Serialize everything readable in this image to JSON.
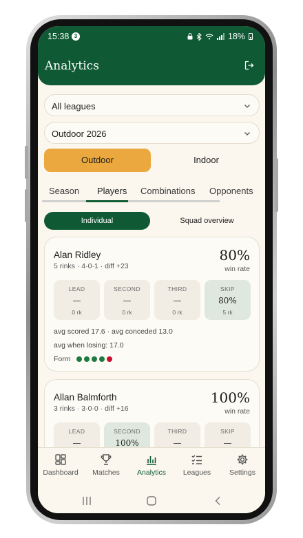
{
  "status_bar": {
    "time": "15:38",
    "notification_count": "3",
    "battery": "18%"
  },
  "app_bar": {
    "title": "Analytics"
  },
  "filters": {
    "league": "All leagues",
    "season": "Outdoor 2026"
  },
  "environment_toggle": {
    "outdoor": "Outdoor",
    "indoor": "Indoor",
    "selected": "Outdoor"
  },
  "tabs": [
    {
      "label": "Season"
    },
    {
      "label": "Players",
      "active": true
    },
    {
      "label": "Combinations"
    },
    {
      "label": "Opponents"
    }
  ],
  "view_toggle": {
    "individual": "Individual",
    "squad": "Squad overview",
    "selected": "Individual"
  },
  "players": [
    {
      "name": "Alan Ridley",
      "meta": "5 rinks · 4·0·1 · diff +23",
      "win_pct": "80%",
      "win_label": "win rate",
      "positions": [
        {
          "name": "LEAD",
          "value": "—",
          "rinks": "0 rk"
        },
        {
          "name": "SECOND",
          "value": "—",
          "rinks": "0 rk"
        },
        {
          "name": "THIRD",
          "value": "—",
          "rinks": "0 rk"
        },
        {
          "name": "SKIP",
          "value": "80%",
          "rinks": "5 rk",
          "highlight": true
        }
      ],
      "avg_line": "avg scored 17.6 · avg conceded 13.0",
      "avg_losing": "avg when losing: 17.0",
      "form_label": "Form",
      "form": [
        "W",
        "W",
        "W",
        "W",
        "L"
      ]
    },
    {
      "name": "Allan Balmforth",
      "meta": "3 rinks · 3·0·0 · diff +16",
      "win_pct": "100%",
      "win_label": "win rate",
      "positions": [
        {
          "name": "LEAD",
          "value": "—"
        },
        {
          "name": "SECOND",
          "value": "100%",
          "highlight": true
        },
        {
          "name": "THIRD",
          "value": "—"
        },
        {
          "name": "SKIP",
          "value": "—"
        }
      ]
    }
  ],
  "bottom_nav": [
    {
      "label": "Dashboard",
      "icon": "dashboard-icon"
    },
    {
      "label": "Matches",
      "icon": "trophy-icon"
    },
    {
      "label": "Analytics",
      "icon": "bar-chart-icon",
      "active": true
    },
    {
      "label": "Leagues",
      "icon": "checklist-icon"
    },
    {
      "label": "Settings",
      "icon": "gear-icon"
    }
  ],
  "colors": {
    "primary": "#0f5a34",
    "accent": "#eaa83f",
    "background": "#fbf7ee",
    "win": "#1e7a3e",
    "loss": "#c8102e"
  }
}
